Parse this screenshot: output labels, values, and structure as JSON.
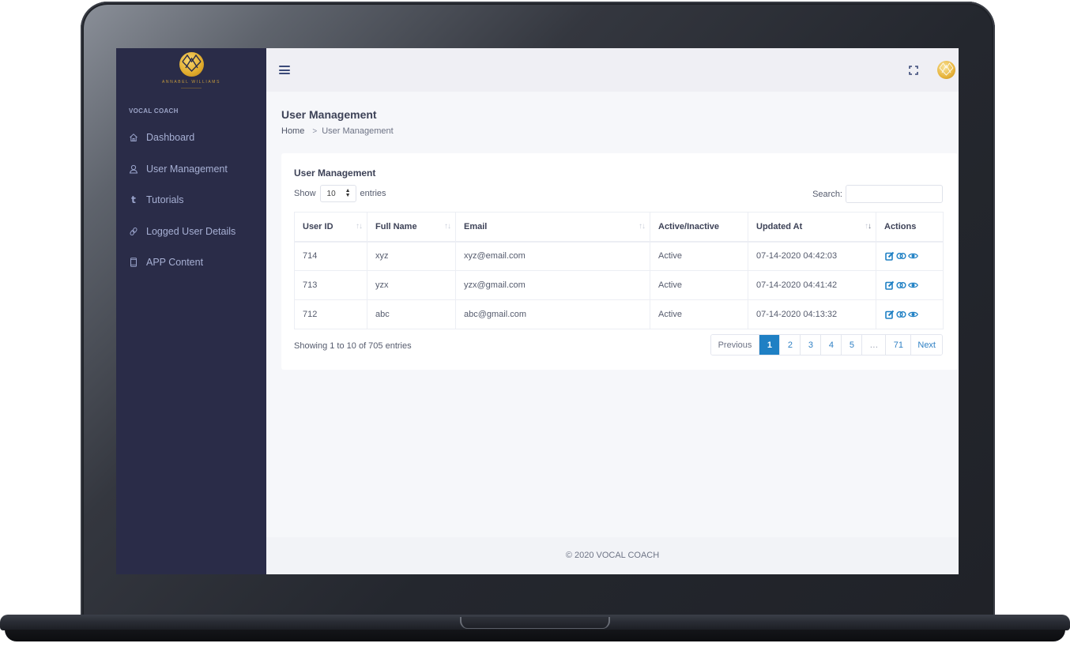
{
  "brand": {
    "logo_name": "ANNABEL WILLIAMS",
    "accent_gold": "#e0ab2c"
  },
  "sidebar": {
    "section_title": "VOCAL COACH",
    "items": [
      {
        "label": "Dashboard",
        "icon": "home-icon"
      },
      {
        "label": "User Management",
        "icon": "user-icon"
      },
      {
        "label": "Tutorials",
        "icon": "tumblr-t-icon"
      },
      {
        "label": "Logged User Details",
        "icon": "link-icon"
      },
      {
        "label": "APP Content",
        "icon": "mobile-icon"
      }
    ]
  },
  "header": {
    "menu_icon": "hamburger-icon",
    "fullscreen_icon": "fullscreen-icon",
    "avatar_icon": "avatar-logo"
  },
  "page": {
    "title": "User Management",
    "breadcrumb": {
      "home": "Home",
      "separator": ">",
      "current": "User Management"
    }
  },
  "card": {
    "title": "User Management",
    "length": {
      "show_label": "Show",
      "value": "10",
      "entries_label": "entries"
    },
    "search": {
      "label": "Search:",
      "value": "",
      "placeholder": ""
    },
    "table": {
      "columns": [
        "User ID",
        "Full Name",
        "Email",
        "Active/Inactive",
        "Updated At",
        "Actions"
      ],
      "rows": [
        {
          "user_id": "714",
          "full_name": "xyz",
          "email": "xyz@email.com",
          "status": "Active",
          "updated_at": "07-14-2020 04:42:03"
        },
        {
          "user_id": "713",
          "full_name": "yzx",
          "email": "yzx@gmail.com",
          "status": "Active",
          "updated_at": "07-14-2020 04:41:42"
        },
        {
          "user_id": "712",
          "full_name": "abc",
          "email": "abc@gmail.com",
          "status": "Active",
          "updated_at": "07-14-2020 04:13:32"
        }
      ],
      "action_icons": [
        "edit-icon",
        "toggle-icon",
        "view-icon"
      ]
    },
    "info": "Showing 1 to 10 of 705 entries",
    "pagination": {
      "previous": "Previous",
      "pages": [
        "1",
        "2",
        "3",
        "4",
        "5"
      ],
      "ellipsis": "…",
      "last": "71",
      "next": "Next",
      "active": "1"
    }
  },
  "footer": {
    "text": "© 2020 VOCAL COACH"
  },
  "colors": {
    "sidebar_bg": "#2a2c48",
    "primary": "#1f80c4",
    "link": "#2f80c4"
  }
}
